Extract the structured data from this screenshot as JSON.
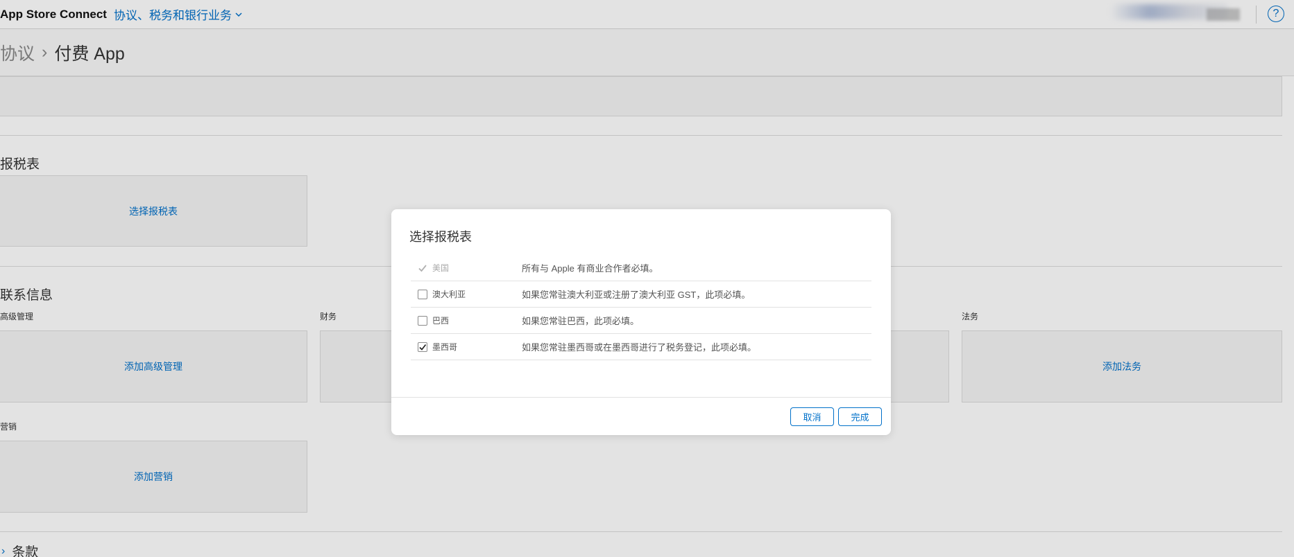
{
  "header": {
    "brand": "App Store Connect",
    "section": "协议、税务和银行业务",
    "help_glyph": "?",
    "accent_color": "#0070c9"
  },
  "breadcrumb": {
    "root": "协议",
    "separator": "›",
    "current": "付费 App"
  },
  "tax_section": {
    "title": "报税表",
    "choose_link": "选择报税表"
  },
  "contact_section": {
    "title": "联系信息",
    "senior_label": "高级管理",
    "senior_link": "添加高级管理",
    "finance_label": "财务",
    "legal_label": "法务",
    "legal_link": "添加法务",
    "marketing_label": "营销",
    "marketing_link": "添加营销"
  },
  "terms": {
    "chevron": "›",
    "label": "条款"
  },
  "modal": {
    "title": "选择报税表",
    "rows": [
      {
        "country": "美国",
        "desc": "所有与 Apple 有商业合作者必填。",
        "state": "required"
      },
      {
        "country": "澳大利亚",
        "desc": "如果您常驻澳大利亚或注册了澳大利亚 GST，此项必填。",
        "state": "unchecked"
      },
      {
        "country": "巴西",
        "desc": "如果您常驻巴西，此项必填。",
        "state": "unchecked"
      },
      {
        "country": "墨西哥",
        "desc": "如果您常驻墨西哥或在墨西哥进行了税务登记，此项必填。",
        "state": "checked"
      }
    ],
    "cancel_label": "取消",
    "done_label": "完成"
  }
}
